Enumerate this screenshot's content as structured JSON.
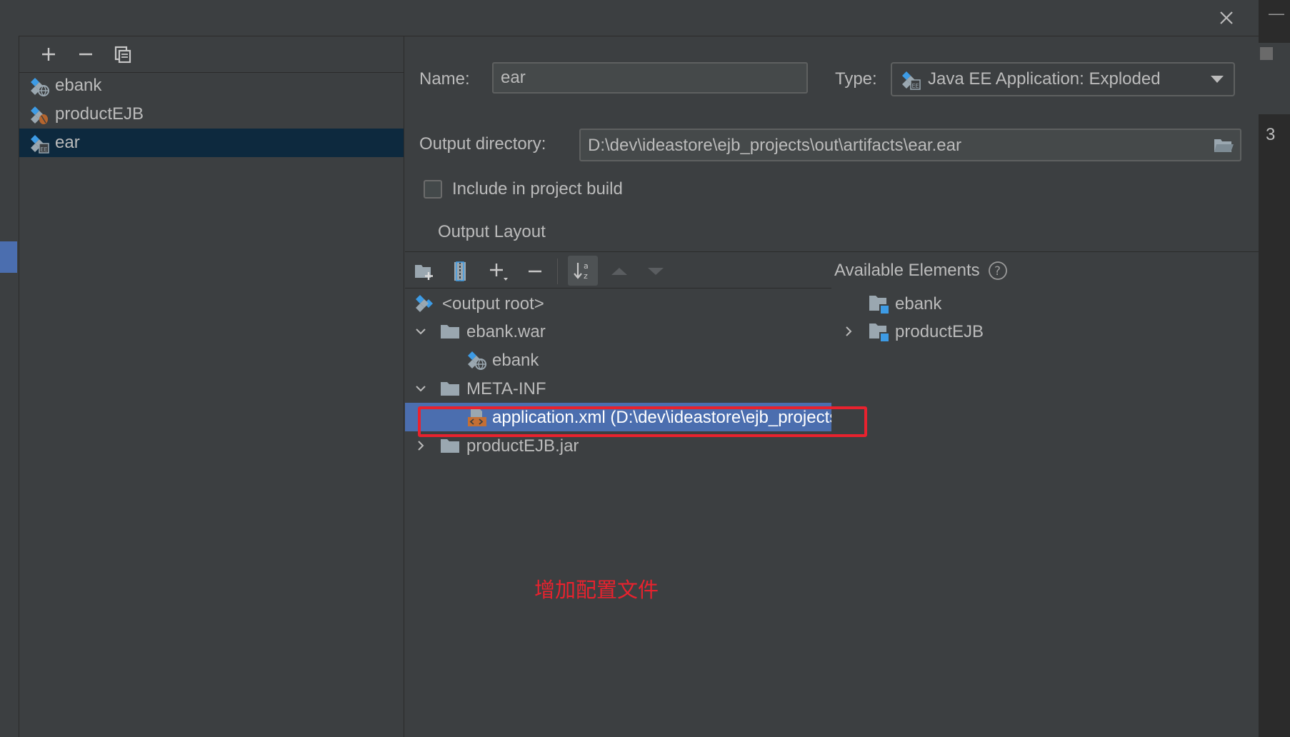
{
  "dialog": {
    "close_icon": "close-icon"
  },
  "artifacts": {
    "toolbar": [
      "add-icon",
      "remove-icon",
      "copy-icon"
    ],
    "items": [
      {
        "label": "ebank",
        "icon": "web-artifact-icon"
      },
      {
        "label": "productEJB",
        "icon": "ejb-artifact-icon"
      },
      {
        "label": "ear",
        "icon": "ear-artifact-icon",
        "selected": true
      }
    ]
  },
  "settings": {
    "name_label": "Name:",
    "name_value": "ear",
    "type_label": "Type:",
    "type_value": "Java EE Application: Exploded",
    "output_dir_label": "Output directory:",
    "output_dir_value": "D:\\dev\\ideastore\\ejb_projects\\out\\artifacts\\ear.ear",
    "include_label": "Include in project build",
    "include_checked": false,
    "output_layout_label": "Output Layout"
  },
  "layout_toolbar": [
    "new-folder-icon",
    "archive-icon",
    "add-icon",
    "remove-icon",
    "sort-az-icon",
    "move-up-icon",
    "move-down-icon"
  ],
  "layout_tree": {
    "output_root": "<output root>",
    "ebank_war": "ebank.war",
    "ebank_war_child": "ebank",
    "meta_inf": "META-INF",
    "application_xml": "application.xml (D:\\dev\\ideastore\\ejb_projects\\ear\\META-INF\\application.xml)",
    "product_jar": "productEJB.jar"
  },
  "available": {
    "title": "Available Elements",
    "items": [
      {
        "label": "ebank",
        "expandable": false
      },
      {
        "label": "productEJB",
        "expandable": true
      }
    ]
  },
  "annotation": "增加配置文件",
  "right_edge_number": "3",
  "colors": {
    "background": "#3c3f41",
    "selection_dark": "#0d293e",
    "selection_blue": "#4b6eaf",
    "annotation_red": "#e8222e",
    "icon_blue": "#3d9be5"
  }
}
